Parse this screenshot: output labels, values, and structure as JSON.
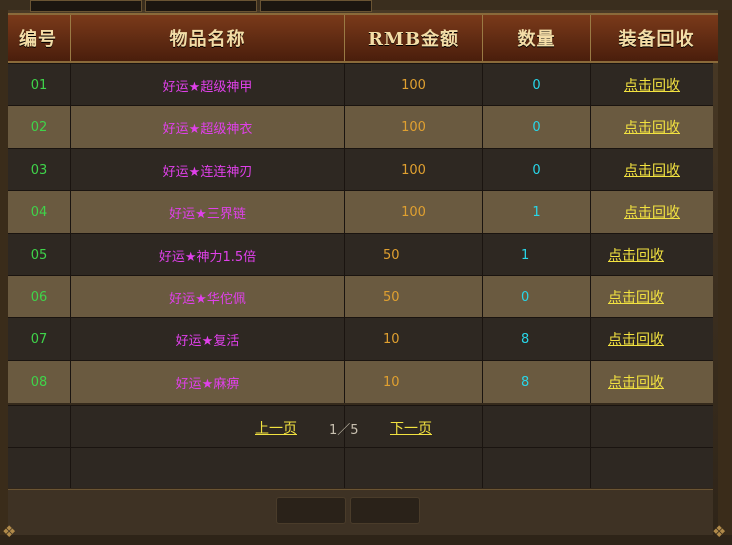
{
  "headers": [
    "编号",
    "物品名称",
    "RMB金额",
    "数量",
    "装备回收"
  ],
  "rows": [
    {
      "id": "01",
      "name": "好运★超级神甲",
      "amount": "100",
      "qty": "0",
      "action": "点击回收"
    },
    {
      "id": "02",
      "name": "好运★超级神衣",
      "amount": "100",
      "qty": "0",
      "action": "点击回收"
    },
    {
      "id": "03",
      "name": "好运★连连神刃",
      "amount": "100",
      "qty": "0",
      "action": "点击回收"
    },
    {
      "id": "04",
      "name": "好运★三界链",
      "amount": "100",
      "qty": "1",
      "action": "点击回收"
    },
    {
      "id": "05",
      "name": "好运★神力1.5倍",
      "amount": "50",
      "qty": "1",
      "action": "点击回收"
    },
    {
      "id": "06",
      "name": "好运★华佗佩",
      "amount": "50",
      "qty": "0",
      "action": "点击回收"
    },
    {
      "id": "07",
      "name": "好运★复活",
      "amount": "10",
      "qty": "8",
      "action": "点击回收"
    },
    {
      "id": "08",
      "name": "好运★麻痹",
      "amount": "10",
      "qty": "8",
      "action": "点击回收"
    }
  ],
  "pager": {
    "prev": "上一页",
    "info": "1／5",
    "next": "下一页"
  },
  "colors": {
    "id": "#3fd34a",
    "name": "#e040ea",
    "amount": "#e0a030",
    "qty": "#28d6e8",
    "link": "#f2e240",
    "header_text": "#f3dda7"
  }
}
